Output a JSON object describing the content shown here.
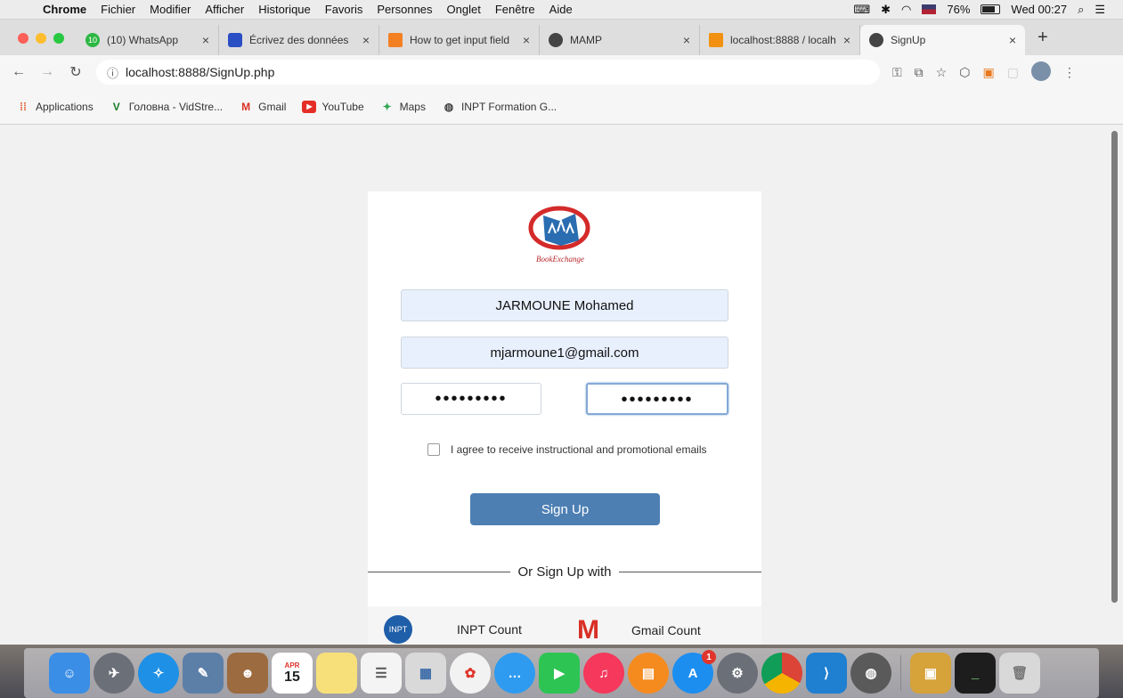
{
  "menubar": {
    "app": "Chrome",
    "menus": [
      "Fichier",
      "Modifier",
      "Afficher",
      "Historique",
      "Favoris",
      "Personnes",
      "Onglet",
      "Fenêtre",
      "Aide"
    ],
    "battery": "76%",
    "clock": "Wed 00:27"
  },
  "tabs": [
    {
      "title": "(10) WhatsApp",
      "badge": "10"
    },
    {
      "title": "Écrivez des données"
    },
    {
      "title": "How to get input field"
    },
    {
      "title": "MAMP"
    },
    {
      "title": "localhost:8888 / localh"
    },
    {
      "title": "SignUp"
    }
  ],
  "address": {
    "url": "localhost:8888/SignUp.php"
  },
  "bookmarks": [
    "Applications",
    "Головна - VidStre...",
    "Gmail",
    "YouTube",
    "Maps",
    "INPT Formation G..."
  ],
  "form": {
    "name_value": "JARMOUNE Mohamed",
    "email_value": "mjarmoune1@gmail.com",
    "password_mask": "•••••••••",
    "confirm_mask": "•••••••••",
    "agree_label": "I agree to receive instructional and promotional emails",
    "submit_label": "Sign Up",
    "divider_label": "Or Sign Up with",
    "inpt_label": "INPT Count",
    "gmail_label": "Gmail Count",
    "logo_text": "BookExchange"
  },
  "dock": {
    "calendar_month": "APR",
    "calendar_day": "15",
    "appstore_badge": "1"
  }
}
